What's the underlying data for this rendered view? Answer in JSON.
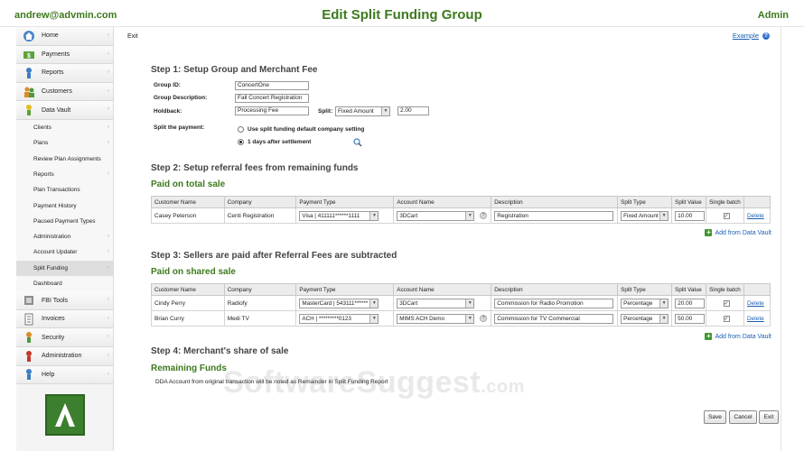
{
  "header": {
    "user": "andrew@advmin.com",
    "title": "Edit Split Funding Group",
    "role": "Admin"
  },
  "sidebar": {
    "top_items": [
      {
        "label": "Home",
        "icon": "home-icon"
      },
      {
        "label": "Payments",
        "icon": "payments-icon"
      },
      {
        "label": "Reports",
        "icon": "reports-icon"
      },
      {
        "label": "Customers",
        "icon": "customers-icon"
      },
      {
        "label": "Data Vault",
        "icon": "data-vault-icon"
      }
    ],
    "sub_items": [
      {
        "label": "Clients"
      },
      {
        "label": "Plans"
      },
      {
        "label": "Review Plan Assignments"
      },
      {
        "label": "Reports"
      },
      {
        "label": "Plan Transactions"
      },
      {
        "label": "Payment History"
      },
      {
        "label": "Paused Payment Types"
      },
      {
        "label": "Administration"
      },
      {
        "label": "Account Updater"
      },
      {
        "label": "Split Funding"
      },
      {
        "label": "Dashboard"
      }
    ],
    "bottom_items": [
      {
        "label": "FBI Tools",
        "icon": "tools-icon"
      },
      {
        "label": "Invoices",
        "icon": "invoices-icon"
      },
      {
        "label": "Security",
        "icon": "security-icon"
      },
      {
        "label": "Administration",
        "icon": "administration-icon"
      },
      {
        "label": "Help",
        "icon": "help-icon"
      }
    ],
    "logo_letter": "A"
  },
  "main": {
    "exit_label": "Exit",
    "example_label": "Example",
    "step1": {
      "title": "Step 1: Setup Group and Merchant Fee",
      "group_id_label": "Group ID:",
      "group_id_value": "ConcertOne",
      "group_desc_label": "Group Description:",
      "group_desc_value": "Fall Concert Registration",
      "holdback_label": "Holdback:",
      "holdback_value": "Processing Fee",
      "split_label": "Split:",
      "split_type": "Fixed Amount",
      "split_amount": "2.00",
      "split_payment_label": "Split the payment:",
      "option_default": "Use split funding default company setting",
      "option_days": "1 days after settlement"
    },
    "step2": {
      "title": "Step 2: Setup referral fees from remaining funds",
      "subtitle": "Paid on total sale",
      "columns": [
        "Customer Name",
        "Company",
        "Payment Type",
        "Account Name",
        "Description",
        "Split Type",
        "Split Value",
        "Single batch",
        ""
      ],
      "rows": [
        {
          "customer": "Casey Peterson",
          "company": "Centi Registration",
          "payment": "Visa | 411111******1111",
          "account": "3DCart",
          "description": "Registration",
          "split_type": "Fixed Amount",
          "split_value": "10.00",
          "delete": "Delete"
        }
      ],
      "add_label": "Add from Data Vault"
    },
    "step3": {
      "title": "Step 3: Sellers are paid after Referral Fees are subtracted",
      "subtitle": "Paid on shared sale",
      "columns": [
        "Customer Name",
        "Company",
        "Payment Type",
        "Account Name",
        "Description",
        "Split Type",
        "Split Value",
        "Single batch",
        ""
      ],
      "rows": [
        {
          "customer": "Cindy Perry",
          "company": "Radiofy",
          "payment": "MasterCard | 543111******",
          "account": "3DCart",
          "description": "Commission for Radio Promotion",
          "split_type": "Percentage",
          "split_value": "20.00",
          "delete": "Delete"
        },
        {
          "customer": "Brian Curry",
          "company": "Medi TV",
          "payment": "ACH | *********0123",
          "account": "MIMS ACH Demo",
          "description": "Commission for TV Commercial",
          "split_type": "Percentage",
          "split_value": "50.00",
          "delete": "Delete"
        }
      ],
      "add_label": "Add from Data Vault"
    },
    "step4": {
      "title": "Step 4: Merchant's share of sale",
      "subtitle": "Remaining Funds",
      "note": "DDA Account from original transaction will be noted as Remainder in Split Funding Report"
    },
    "buttons": {
      "save": "Save",
      "cancel": "Cancel",
      "exit": "Exit"
    },
    "watermark": {
      "main": "SoftwareSuggest",
      "suffix": ".com"
    }
  }
}
